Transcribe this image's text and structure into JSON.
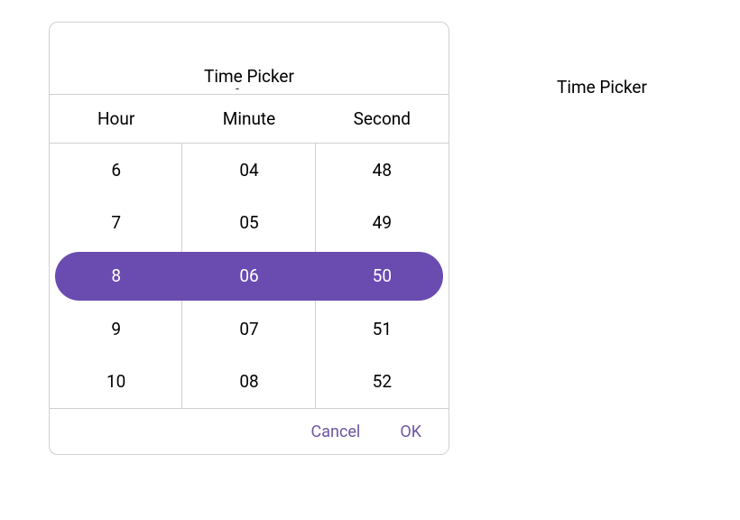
{
  "header": {
    "title": "Time Picker"
  },
  "columns": {
    "hour": {
      "label": "Hour",
      "items": [
        "6",
        "7",
        "8",
        "9",
        "10"
      ],
      "selected_index": 2
    },
    "minute": {
      "label": "Minute",
      "items": [
        "04",
        "05",
        "06",
        "07",
        "08"
      ],
      "selected_index": 2
    },
    "second": {
      "label": "Second",
      "items": [
        "48",
        "49",
        "50",
        "51",
        "52"
      ],
      "selected_index": 2
    }
  },
  "footer": {
    "cancel_label": "Cancel",
    "ok_label": "OK"
  },
  "callout": {
    "label": "Time Picker"
  },
  "accent_color": "#6a4bb0"
}
